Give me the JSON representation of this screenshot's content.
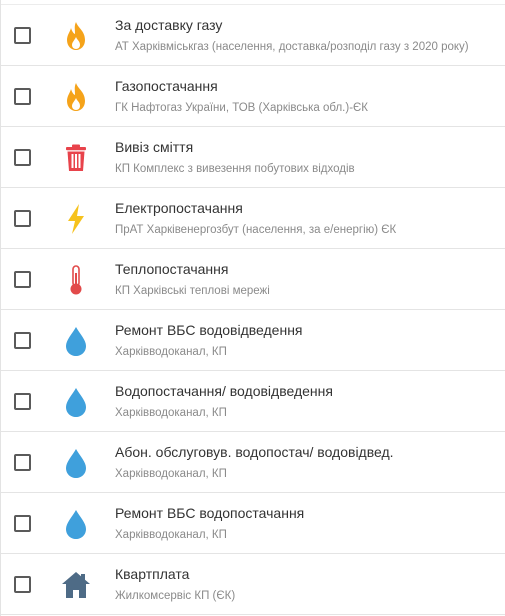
{
  "services": [
    {
      "icon": "flame-icon",
      "title": "За доставку газу",
      "provider": "АТ Харківміськгаз (населення, доставка/розподіл газу з 2020 року)",
      "checked": false
    },
    {
      "icon": "flame-icon",
      "title": "Газопостачання",
      "provider": "ГК Нафтогаз України, ТОВ (Харківська обл.)-ЄК",
      "checked": false
    },
    {
      "icon": "trash-icon",
      "title": "Вивіз сміття",
      "provider": "КП Комплекс з вивезення побутових відходів",
      "checked": false
    },
    {
      "icon": "lightning-icon",
      "title": "Електропостачання",
      "provider": "ПрАТ Харківенергозбут (населення, за е/енергію) ЄК",
      "checked": false
    },
    {
      "icon": "thermometer-icon",
      "title": "Теплопостачання",
      "provider": "КП Харківські теплові мережі",
      "checked": false
    },
    {
      "icon": "water-drop-icon",
      "title": "Ремонт ВБС водовідведення",
      "provider": "Харківводоканал, КП",
      "checked": false
    },
    {
      "icon": "water-drop-icon",
      "title": "Водопостачання/ водовідведення",
      "provider": "Харківводоканал, КП",
      "checked": false
    },
    {
      "icon": "water-drop-icon",
      "title": "Абон. обслуговув. водопостач/ водовідвед.",
      "provider": "Харківводоканал, КП",
      "checked": false
    },
    {
      "icon": "water-drop-icon",
      "title": "Ремонт ВБС водопостачання",
      "provider": "Харківводоканал, КП",
      "checked": false
    },
    {
      "icon": "house-icon",
      "title": "Квартплата",
      "provider": "Жилкомсервіс КП (ЄК)",
      "checked": false
    }
  ],
  "colors": {
    "flame": "#f5a31a",
    "flame_inner": "#ffffff",
    "trash": "#e8434b",
    "lightning": "#f6c21d",
    "thermometer": "#e24a4a",
    "water": "#3fa0dc",
    "house": "#4e6b86"
  }
}
